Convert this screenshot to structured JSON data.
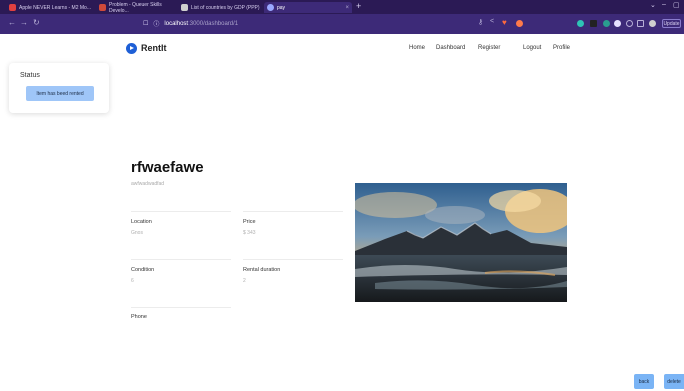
{
  "browser": {
    "tabs": [
      {
        "title": "Apple NEVER Learns - M2 Mo..."
      },
      {
        "title": "Problem - Queuer Skills Develo..."
      },
      {
        "title": "List of countries by GDP (PPP)"
      },
      {
        "title": "pay"
      }
    ],
    "url_host": "localhost",
    "url_path": ":3000/dashboard/1",
    "update_label": "Update"
  },
  "nav": {
    "brand": "RentIt",
    "links": [
      "Home",
      "Dashboard",
      "Register",
      "Logout",
      "Profile"
    ]
  },
  "status": {
    "title": "Status",
    "message": "Item has beed rented"
  },
  "item": {
    "title": "rfwaefawe",
    "subtitle": "awfwadwadfad",
    "fields": {
      "location_label": "Location",
      "location_value": "Gnos",
      "price_label": "Price",
      "price_value": "$ 343",
      "condition_label": "Condition",
      "condition_value": "6",
      "rental_duration_label": "Rental duration",
      "rental_duration_value": "2",
      "phone_label": "Phone"
    }
  },
  "actions": {
    "back_label": "back",
    "delete_label": "delete"
  }
}
